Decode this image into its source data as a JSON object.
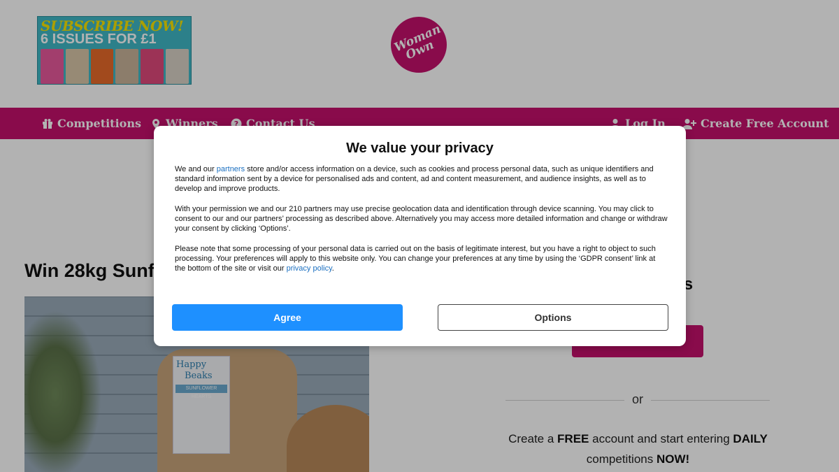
{
  "header": {
    "promo": {
      "line1": "SUBSCRIBE NOW!",
      "line2": "6 ISSUES FOR £1",
      "colors": {
        "bg": "#3fb8c6",
        "headline": "#f7e400"
      }
    },
    "logo": {
      "line1": "Woman's",
      "line2": "Own",
      "color": "#c4106c"
    }
  },
  "nav": {
    "color": "#c4106c",
    "items": [
      {
        "label": "Competitions",
        "icon": "gift-icon"
      },
      {
        "label": "Winners",
        "icon": "location-pin-icon"
      },
      {
        "label": "Contact Us",
        "icon": "question-icon"
      }
    ],
    "right_items": [
      {
        "label": "Log In",
        "icon": "user-icon"
      },
      {
        "label": "Create Free Account",
        "icon": "user-plus-icon"
      }
    ]
  },
  "main": {
    "article_title": "Win 28kg Sunf",
    "hero_image": {
      "alt": "Happy Beaks sunflower hearts sack",
      "brand_line1": "Happy",
      "brand_line2": "Beaks",
      "product": "SUNFLOWER HEARTS"
    }
  },
  "sidebar": {
    "heading_partial": "ers",
    "divider_text": "or",
    "cta": {
      "prefix": "Create a ",
      "free": "FREE",
      "middle": " account and start entering ",
      "daily": "DAILY",
      "line2_prefix": "competitions ",
      "now": "NOW!"
    }
  },
  "consent": {
    "title": "We value your privacy",
    "p1_before": "We and our ",
    "p1_link": "partners",
    "p1_after": " store and/or access information on a device, such as cookies and process personal data, such as unique identifiers and standard information sent by a device for personalised ads and content, ad and content measurement, and audience insights, as well as to develop and improve products.",
    "p2": "With your permission we and our 210 partners may use precise geolocation data and identification through device scanning. You may click to consent to our and our partners’ processing as described above. Alternatively you may access more detailed information and change or withdraw your consent by clicking ‘Options’.",
    "p3_before": "Please note that some processing of your personal data is carried out on the basis of legitimate interest, but you have a right to object to such processing. Your preferences will apply to this website only. You can change your preferences at any time by using the ‘GDPR consent’ link at the bottom of the site or visit our ",
    "p3_link": "privacy policy",
    "p3_after": ".",
    "agree_label": "Agree",
    "options_label": "Options",
    "colors": {
      "agree": "#1e90ff",
      "link": "#1a6fc0"
    }
  }
}
